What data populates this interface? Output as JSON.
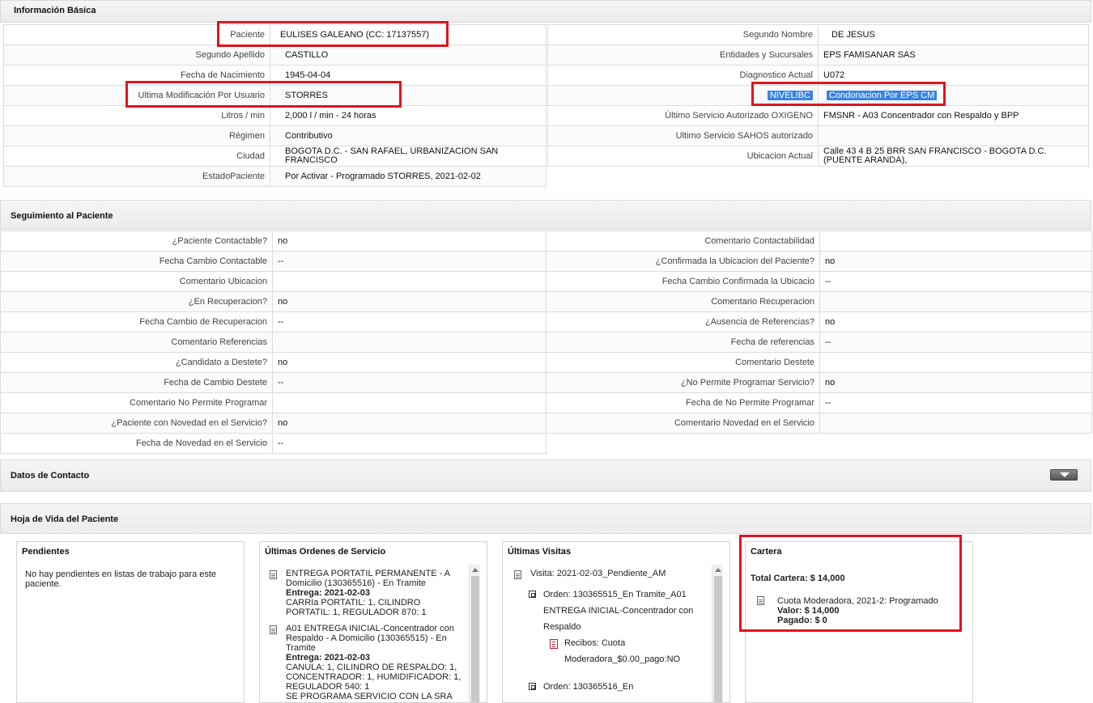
{
  "basic": {
    "title": "Información Básica",
    "left": [
      {
        "label": "Paciente",
        "value": "EULISES GALEANO (CC: 17137557)"
      },
      {
        "label": "Segundo Apellido",
        "value": "CASTILLO"
      },
      {
        "label": "Fecha de Nacimiento",
        "value": "1945-04-04"
      },
      {
        "label": "Ultima Modificación Por Usuario",
        "value": "STORRES"
      },
      {
        "label": "Litros / min",
        "value": "2,000 l / min - 24 horas"
      },
      {
        "label": "Régimen",
        "value": "Contributivo"
      },
      {
        "label": "Ciudad",
        "value": "BOGOTA D.C. - SAN RAFAEL, URBANIZACION SAN FRANCISCO"
      },
      {
        "label": "EstadoPaciente",
        "value": "Por Activar - Programado STORRES, 2021-02-02"
      }
    ],
    "right": [
      {
        "label": "Segundo Nombre",
        "value": "DE JESUS"
      },
      {
        "label": "Entidades y Sucursales",
        "value": "EPS FAMISANAR SAS"
      },
      {
        "label": "Diagnostico Actual",
        "value": "U072"
      },
      {
        "label": "NIVELIBC",
        "value": "Condonacion Por EPS CM"
      },
      {
        "label": "Último Servicio Autorizado OXIGENO",
        "value": "FMSNR - A03 Concentrador con Respaldo y BPP"
      },
      {
        "label": "Ultimo Servicio SAHOS autorizado",
        "value": ""
      },
      {
        "label": "Ubicacion Actual",
        "value": "Calle 43 4 B 25 BRR SAN FRANCISCO - BOGOTA D.C. (PUENTE ARANDA),"
      }
    ]
  },
  "seguimiento": {
    "title": "Seguimiento al Paciente",
    "left": [
      {
        "label": "¿Paciente Contactable?",
        "value": "no"
      },
      {
        "label": "Fecha Cambio Contactable",
        "value": "--"
      },
      {
        "label": "Comentario Ubicacion",
        "value": ""
      },
      {
        "label": "¿En Recuperacion?",
        "value": "no"
      },
      {
        "label": "Fecha Cambio de Recuperacion",
        "value": "--"
      },
      {
        "label": "Comentario Referencias",
        "value": ""
      },
      {
        "label": "¿Candidato a Destete?",
        "value": "no"
      },
      {
        "label": "Fecha de Cambio Destete",
        "value": "--"
      },
      {
        "label": "Comentario No Permite Programar",
        "value": ""
      },
      {
        "label": "¿Paciente con Novedad en el Servicio?",
        "value": "no"
      },
      {
        "label": "Fecha de Novedad en el Servicio",
        "value": "--"
      }
    ],
    "right": [
      {
        "label": "Comentario Contactabilidad",
        "value": ""
      },
      {
        "label": "¿Confirmada la Ubicacion del Paciente?",
        "value": "no"
      },
      {
        "label": "Fecha Cambio Confirmada la Ubicacio",
        "value": "--"
      },
      {
        "label": "Comentario Recuperacion",
        "value": ""
      },
      {
        "label": "¿Ausencia de Referencias?",
        "value": "no"
      },
      {
        "label": "Fecha de referencias",
        "value": "--"
      },
      {
        "label": "Comentario Destete",
        "value": ""
      },
      {
        "label": "¿No Permite Programar Servicio?",
        "value": "no"
      },
      {
        "label": "Fecha de No Permite Programar",
        "value": "--"
      },
      {
        "label": "Comentario Novedad en el Servicio",
        "value": ""
      }
    ]
  },
  "contacto": {
    "title": "Datos de Contacto",
    "toggle_icon": "chevron-down-icon"
  },
  "hoja": {
    "title": "Hoja de Vida del Paciente",
    "pendientes": {
      "title": "Pendientes",
      "text": "No hay pendientes en listas de trabajo para este paciente."
    },
    "ordenes": {
      "title": "Últimas Ordenes de Servicio",
      "items": [
        {
          "line1": "ENTREGA PORTATIL PERMANENTE - A Domicilio (130365516) - En Tramite",
          "entrega_label": "Entrega:",
          "entrega_date": "2021-02-03",
          "detail": "CARRIa PORTATIL: 1, CILINDRO PORTATIL: 1, REGULADOR 870: 1"
        },
        {
          "line1": "A01 ENTREGA INICIAL-Concentrador con Respaldo - A Domicilio (130365515) - En Tramite",
          "entrega_label": "Entrega:",
          "entrega_date": "2021-02-03",
          "detail": "CANULA: 1, CILINDRO DE RESPALDO: 1, CONCENTRADOR: 1, HUMIDIFICADOR: 1, REGULADOR 540: 1",
          "extra": "SE PROGRAMA SERVICIO CON LA SRA"
        }
      ]
    },
    "visitas": {
      "title": "Últimas Visitas",
      "visita": "Visita: 2021-02-03_Pendiente_AM",
      "orden1": "Orden: 130365515_En Tramite_A01 ENTREGA INICIAL-Concentrador con Respaldo",
      "recibos": "Recibos: Cuota Moderadora_$0.00_pago:NO",
      "orden2": "Orden: 130365516_En"
    },
    "cartera": {
      "title": "Cartera",
      "total": "Total Cartera: $ 14,000",
      "item": "Cuota Moderadora, 2021-2: Programado",
      "valor": "Valor: $ 14,000",
      "pagado": "Pagado: $ 0"
    }
  },
  "colors": {
    "highlight": "#e0141e",
    "selection": "#3a83e0"
  }
}
